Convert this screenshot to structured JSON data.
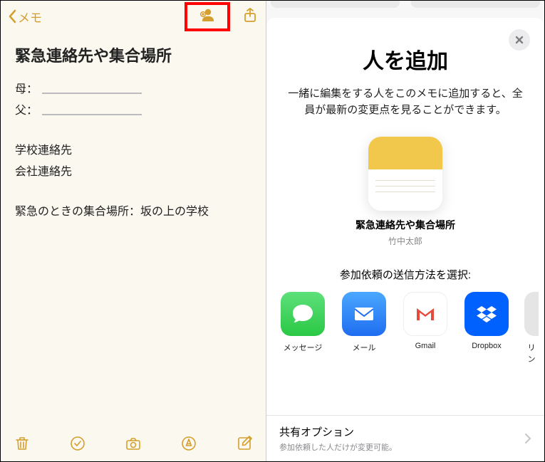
{
  "left": {
    "back_label": "メモ",
    "title": "緊急連絡先や集合場所",
    "lines": {
      "mother_label": "母：",
      "father_label": "父：",
      "school": "学校連絡先",
      "company": "会社連絡先",
      "meeting": "緊急のときの集合場所：坂の上の学校"
    }
  },
  "right": {
    "title": "人を追加",
    "desc": "一緒に編集をする人をこのメモに追加すると、全員が最新の変更点を見ることができます。",
    "note_name": "緊急連絡先や集合場所",
    "note_owner": "竹中太郎",
    "send_label": "参加依頼の送信方法を選択:",
    "apps": {
      "messages": "メッセージ",
      "mail": "メール",
      "gmail": "Gmail",
      "dropbox": "Dropbox",
      "link_partial": "リン"
    },
    "option": {
      "title": "共有オプション",
      "subtitle": "参加依頼した人だけが変更可能。"
    }
  }
}
